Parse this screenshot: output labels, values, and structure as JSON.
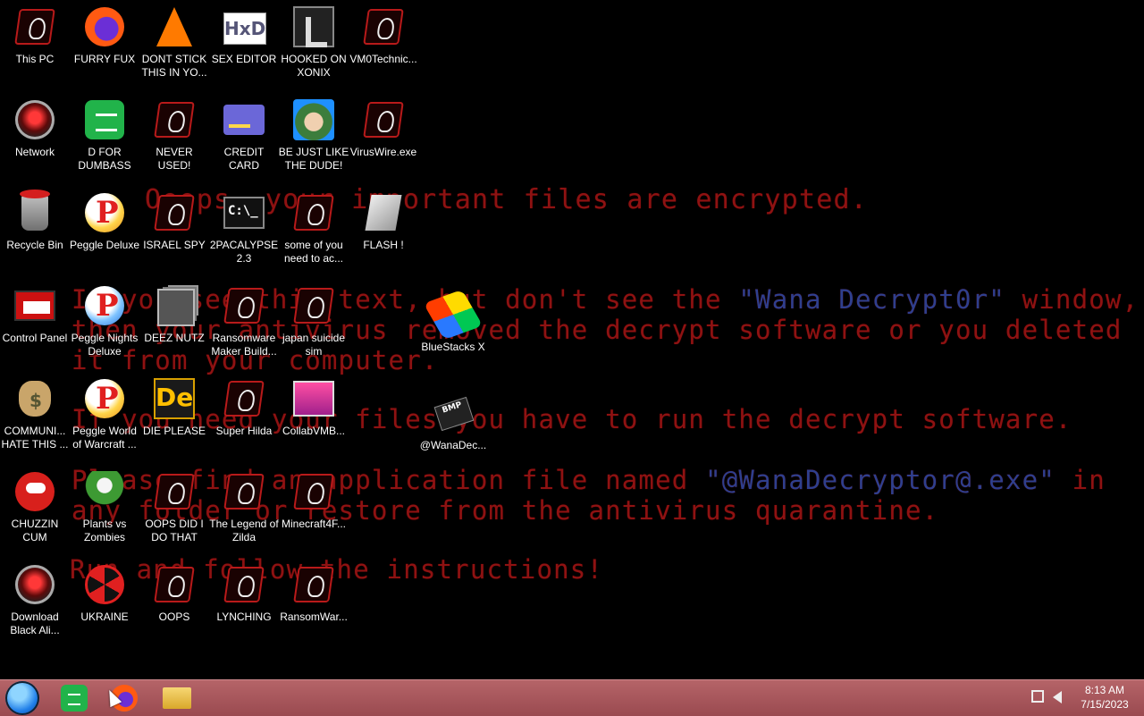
{
  "wallpaper": {
    "line0": "Ooops, your important files are encrypted.",
    "line1_a": "If you see this text, but don't see the ",
    "line1_b": "\"Wana Decrypt0r\"",
    "line1_c": " window,",
    "line2": "then your antivirus removed the decrypt software or you deleted",
    "line3": "it from your computer.",
    "line4": "If you need your files you have to run the decrypt software.",
    "line5_a": "Please find an application file named ",
    "line5_b": "\"@WanaDecryptor@.exe\"",
    "line5_c": " in",
    "line6": "any folder or restore from the antivirus quarantine.",
    "line7": "Run and follow the instructions!",
    "text_color": "#8e1212",
    "highlight_color": "#2e3f8e"
  },
  "desktop": {
    "icons": [
      {
        "label": "This PC",
        "icon": "wana-icon"
      },
      {
        "label": "FURRY FUX",
        "icon": "firefox-icon"
      },
      {
        "label": "DONT STICK THIS IN YO...",
        "icon": "vlc-icon"
      },
      {
        "label": "SEX EDITOR",
        "icon": "hxd-icon"
      },
      {
        "label": "HOOKED ON XONIX",
        "icon": "xonix-icon"
      },
      {
        "label": "VM0Technic...",
        "icon": "wana-icon"
      },
      {
        "label": "Network",
        "icon": "alien-icon"
      },
      {
        "label": "D FOR DUMBASS",
        "icon": "glob-icon"
      },
      {
        "label": "NEVER USED!",
        "icon": "wana-icon"
      },
      {
        "label": "CREDIT CARD CHECKER",
        "icon": "credit-card-icon"
      },
      {
        "label": "BE JUST LIKE THE DUDE!",
        "icon": "santa-icon"
      },
      {
        "label": "VirusWire.exe",
        "icon": "wana-icon"
      },
      {
        "label": "Recycle Bin",
        "icon": "recycle-bin-icon"
      },
      {
        "label": "Peggle Deluxe",
        "icon": "peggle-icon"
      },
      {
        "label": "ISRAEL SPY",
        "icon": "wana-icon"
      },
      {
        "label": "2PACALYPSE 2.3",
        "icon": "cmd-icon"
      },
      {
        "label": "some of you need to ac...",
        "icon": "wana-icon"
      },
      {
        "label": "FLASH !",
        "icon": "flash-icon"
      },
      {
        "label": "Control Panel",
        "icon": "control-panel-icon"
      },
      {
        "label": "Peggle Nights Deluxe",
        "icon": "peggle-icon"
      },
      {
        "label": "DEEZ NUTZ",
        "icon": "stack-icon"
      },
      {
        "label": "Ransomware Maker Build...",
        "icon": "wana-icon"
      },
      {
        "label": "japan suicide sim",
        "icon": "wana-icon"
      },
      {
        "label": "BlueStacks X",
        "icon": "bluestacks-icon"
      },
      {
        "label": "COMMUNI... HATE THIS ...",
        "icon": "money-sack-icon"
      },
      {
        "label": "Peggle World of Warcraft ...",
        "icon": "peggle-icon"
      },
      {
        "label": "DIE PLEASE",
        "icon": "de-icon"
      },
      {
        "label": "Super Hilda",
        "icon": "wana-icon"
      },
      {
        "label": "CollabVMB...",
        "icon": "collab-icon"
      },
      {
        "label": "@WanaDec...",
        "icon": "bmp-icon"
      },
      {
        "label": "CHUZZIN CUM",
        "icon": "chuzzle-icon"
      },
      {
        "label": "Plants vs Zombies",
        "icon": "pvz-icon"
      },
      {
        "label": "OOPS DID I DO THAT",
        "icon": "wana-icon"
      },
      {
        "label": "The Legend of Zilda",
        "icon": "wana-icon"
      },
      {
        "label": "Minecraft4F...",
        "icon": "wana-icon"
      },
      {
        "label": "Download Black Ali...",
        "icon": "alien-icon"
      },
      {
        "label": "UKRAINE",
        "icon": "nuclear-icon"
      },
      {
        "label": "OOPS",
        "icon": "wana-icon"
      },
      {
        "label": "LYNCHING",
        "icon": "wana-icon"
      },
      {
        "label": "RansomWar...",
        "icon": "wana-icon"
      }
    ]
  },
  "taskbar": {
    "start_icon": "start-orb-icon",
    "pinned": [
      "glob-icon",
      "firefox-icon",
      "folder-icon"
    ],
    "tray": [
      "network-icon",
      "volume-icon"
    ],
    "time": "8:13 AM",
    "date": "7/15/2023",
    "color": "#a8565b"
  }
}
